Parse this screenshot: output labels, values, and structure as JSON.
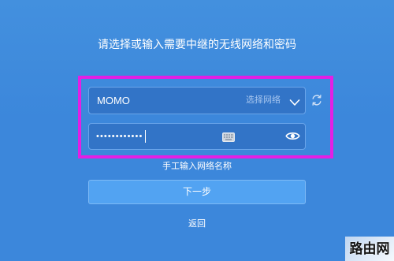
{
  "page": {
    "title": "请选择或输入需要中继的无线网络和密码"
  },
  "network_select": {
    "selected_value": "MOMO",
    "hint": "选择网络",
    "chevron_icon": "chevron-down-icon",
    "refresh_icon": "refresh-icon"
  },
  "password_field": {
    "masked_value": "••••••••••••",
    "keyboard_icon": "keyboard-icon",
    "visibility_icon": "eye-icon"
  },
  "manual_entry_link": "手工输入网络名称",
  "next_button": "下一步",
  "back_link": "返回",
  "watermark": "路由网",
  "colors": {
    "background": "#3c87db",
    "field_background": "#3274c7",
    "field_border": "#6aa5ea",
    "button_background": "#52a3f2",
    "highlight": "#e41fe4",
    "text": "#ffffff",
    "hint_text": "#a7c6ef"
  }
}
